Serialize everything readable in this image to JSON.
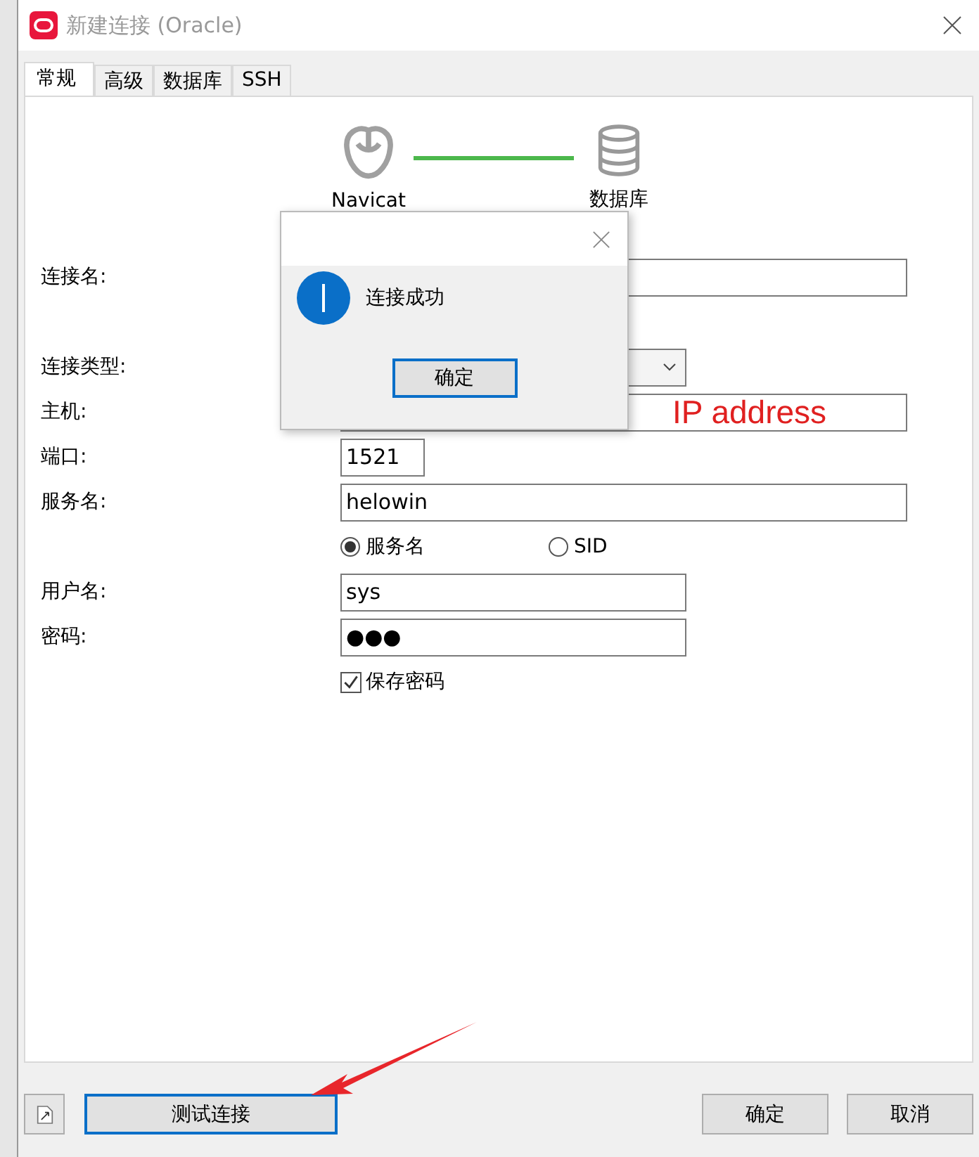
{
  "window": {
    "title": "新建连接 (Oracle)"
  },
  "tabs": [
    {
      "label": "常规",
      "selected": true
    },
    {
      "label": "高级",
      "selected": false
    },
    {
      "label": "数据库",
      "selected": false
    },
    {
      "label": "SSH",
      "selected": false
    }
  ],
  "diagram": {
    "left_label": "Navicat",
    "right_label": "数据库"
  },
  "form": [
    {
      "kind": "text-wide",
      "label": "连接名:"
    },
    {
      "kind": "select",
      "label": "连接类型:"
    },
    {
      "kind": "text-wide",
      "label": "主机:",
      "annotation": "IP address"
    },
    {
      "kind": "number",
      "label": "端口:",
      "value": "1521"
    },
    {
      "kind": "text-wide",
      "label": "服务名:",
      "value": "helowin"
    },
    {
      "kind": "radio-group",
      "options": [
        {
          "label": "服务名",
          "selected": true
        },
        {
          "label": "SID",
          "selected": false
        }
      ]
    },
    {
      "kind": "text",
      "label": "用户名:",
      "value": "sys"
    },
    {
      "kind": "text",
      "label": "密码:",
      "value": "●●●"
    },
    {
      "kind": "checkbox",
      "label": "保存密码",
      "checked": true
    }
  ],
  "footer": {
    "test_button": {
      "label": "测试连接",
      "focused": true
    },
    "ok_button": "确定",
    "cancel_button": "取消"
  },
  "message_box": {
    "message": "连接成功",
    "button": {
      "label": "确定",
      "focused": true
    }
  }
}
